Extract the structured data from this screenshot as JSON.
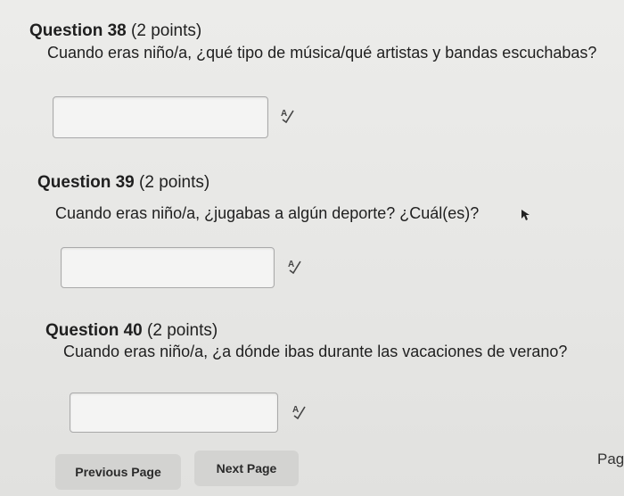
{
  "questions": [
    {
      "number": "Question 38",
      "points": "(2 points)",
      "text": "Cuando eras niño/a, ¿qué tipo de música/qué artistas y bandas escuchabas?",
      "answer": ""
    },
    {
      "number": "Question 39",
      "points": "(2 points)",
      "text": "Cuando eras niño/a, ¿jugabas a algún deporte? ¿Cuál(es)?",
      "answer": ""
    },
    {
      "number": "Question 40",
      "points": "(2 points)",
      "text": "Cuando eras niño/a, ¿a dónde ibas durante las vacaciones de verano?",
      "answer": ""
    }
  ],
  "nav": {
    "previous_label": "Previous Page",
    "next_label": "Next Page",
    "page_label": "Page"
  },
  "icons": {
    "spellcheck": "spellcheck-icon",
    "cursor": "mouse-cursor-icon"
  }
}
